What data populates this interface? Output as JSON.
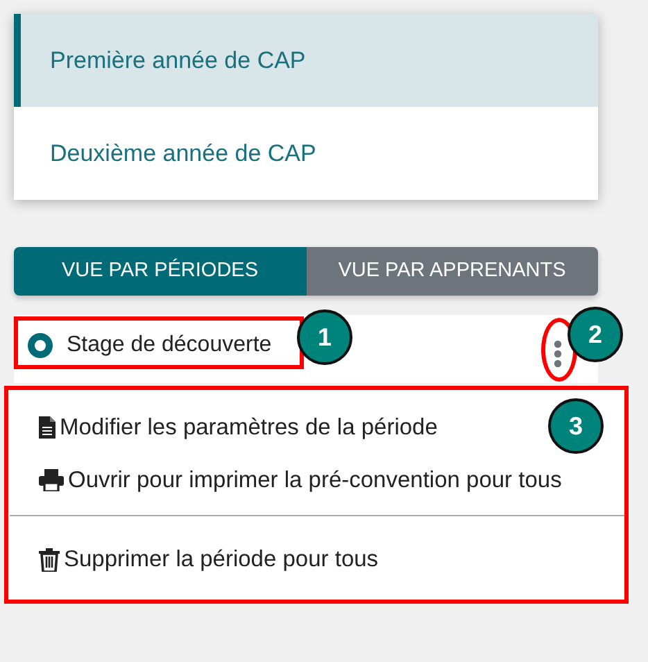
{
  "classes": [
    {
      "label": "Première année de CAP",
      "selected": true
    },
    {
      "label": "Deuxième année de CAP",
      "selected": false
    }
  ],
  "view_tabs": [
    {
      "label": "VUE PAR PÉRIODES",
      "selected": true
    },
    {
      "label": "VUE PAR APPRENANTS",
      "selected": false
    }
  ],
  "period": {
    "label": "Stage de découverte",
    "selected": true
  },
  "menu": [
    {
      "kind": "item",
      "label": "Modifier les paramètres de la période"
    },
    {
      "kind": "item",
      "label": "Ouvrir pour imprimer la pré-convention pour tous"
    },
    {
      "kind": "divider"
    },
    {
      "kind": "item",
      "label": "Supprimer la période pour tous"
    }
  ],
  "callouts": [
    {
      "label": "1"
    },
    {
      "label": "2"
    },
    {
      "label": "3"
    }
  ]
}
